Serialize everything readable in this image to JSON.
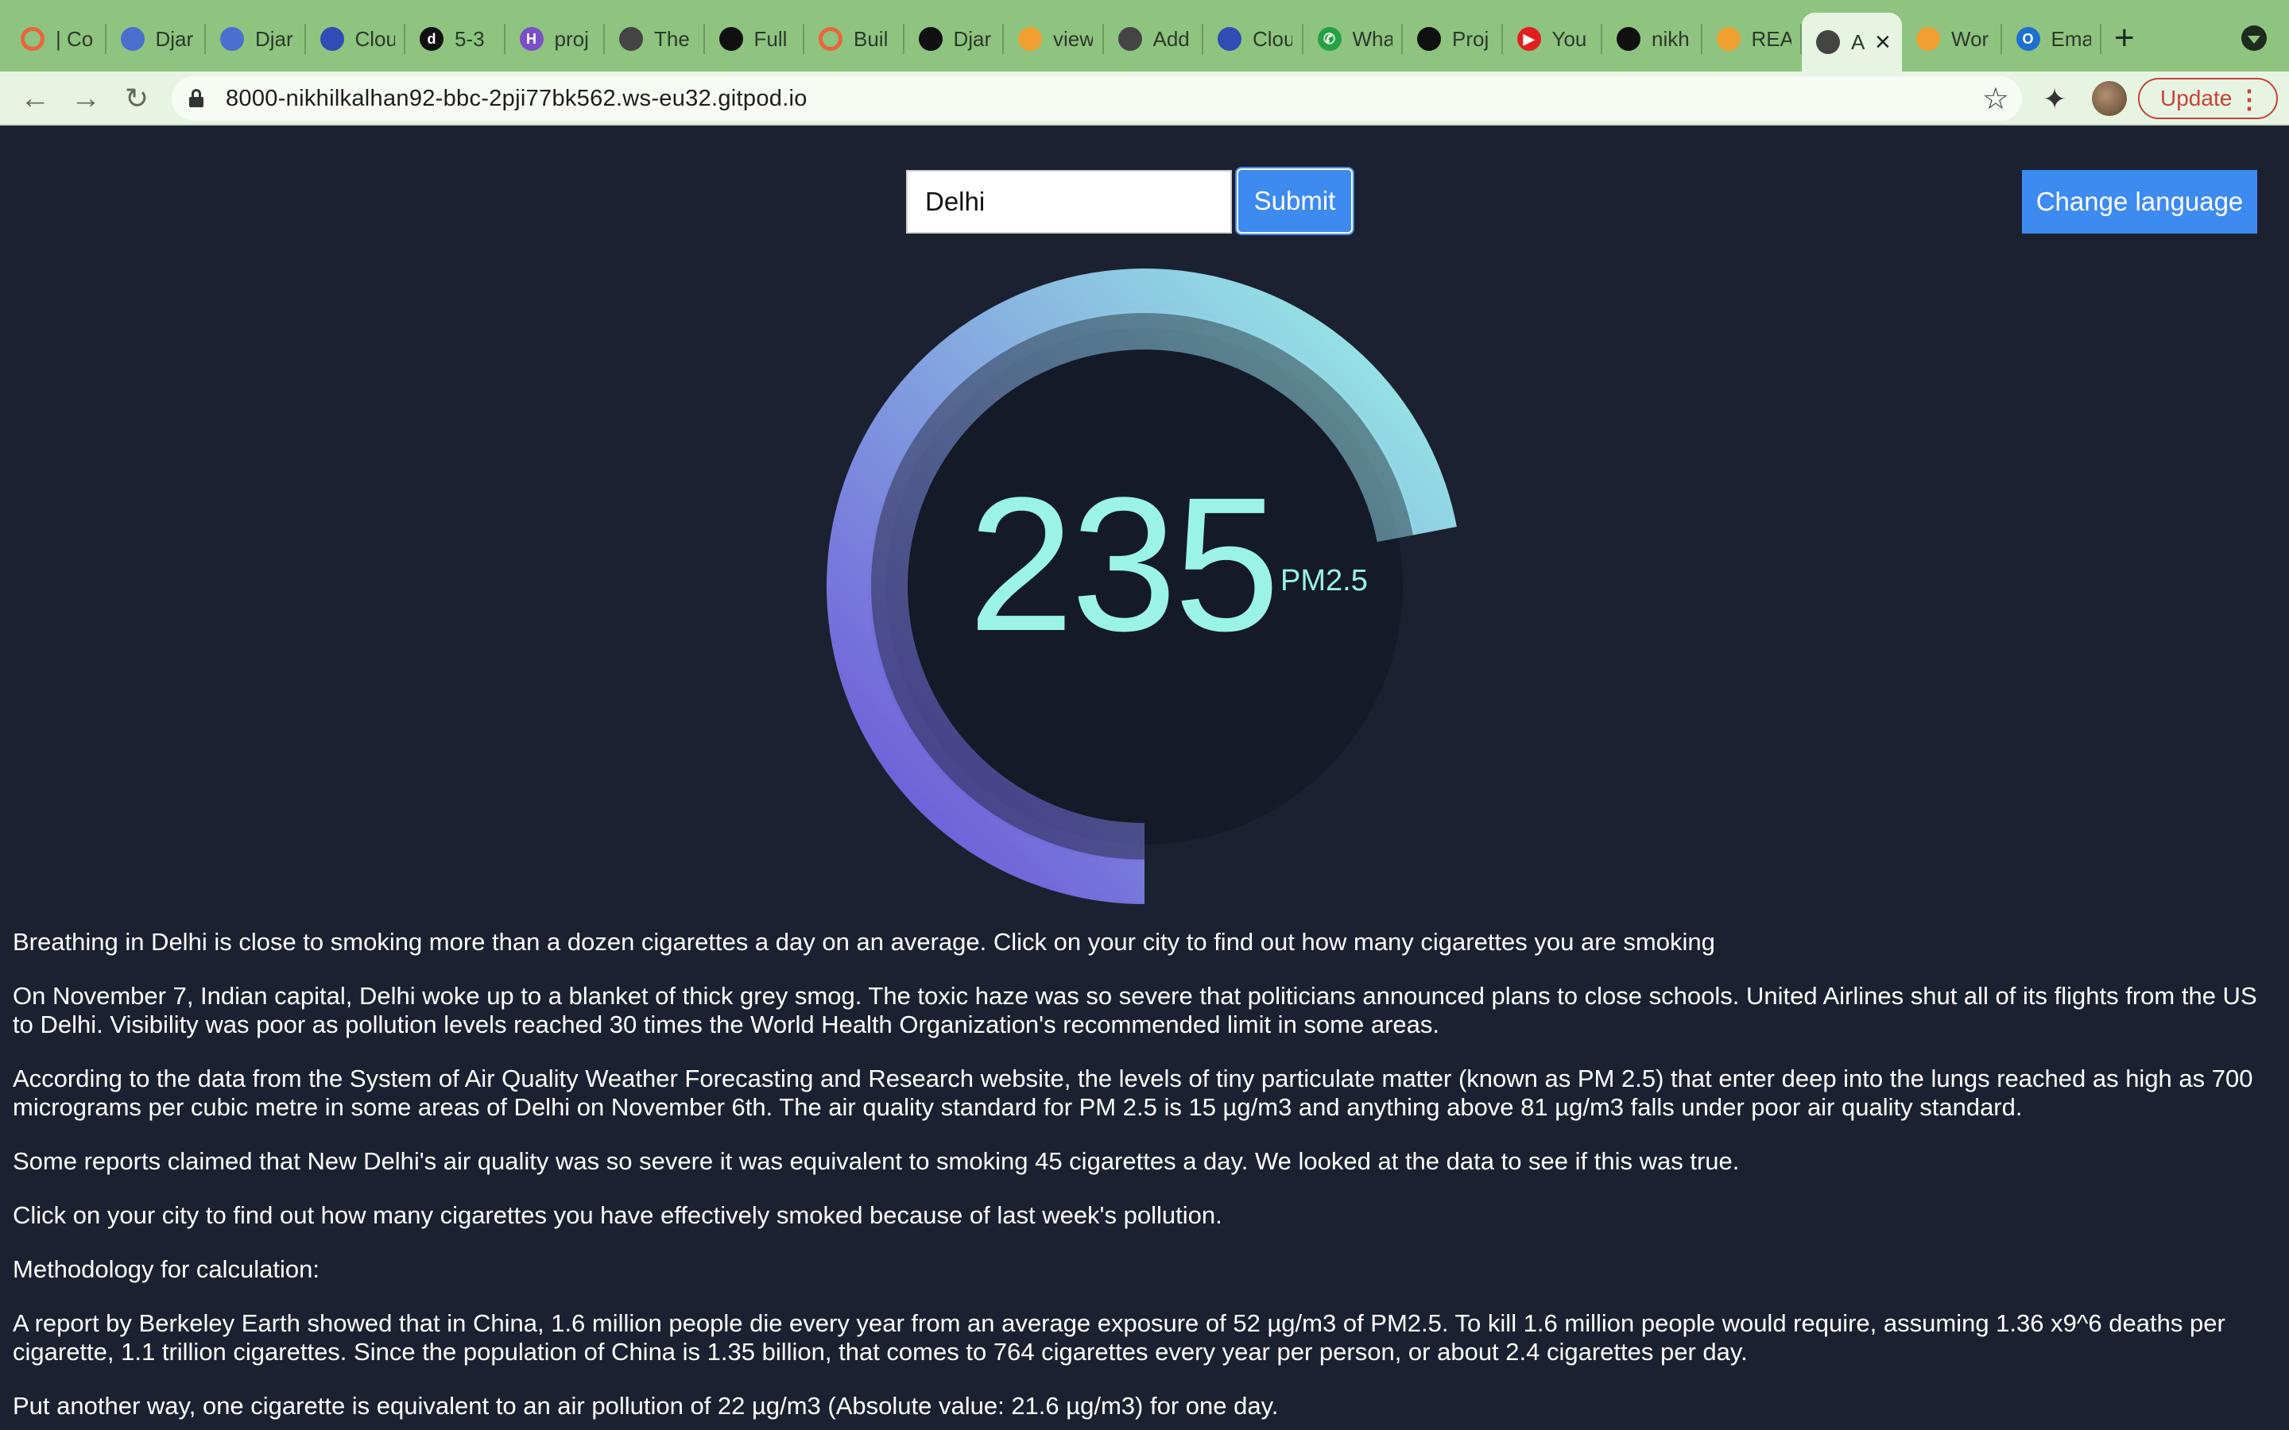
{
  "browser": {
    "tabs": [
      {
        "label": "| Co",
        "icon": "orange-ring-icon",
        "color": "#e8663a"
      },
      {
        "label": "Djar",
        "icon": "globe-crest-icon",
        "color": "#4a6fd1"
      },
      {
        "label": "Djar",
        "icon": "globe-crest-icon",
        "color": "#4a6fd1"
      },
      {
        "label": "Clou",
        "icon": "cloud-icon",
        "color": "#2f4db5"
      },
      {
        "label": "5-3",
        "icon": "d-letter-icon",
        "color": "#111111"
      },
      {
        "label": "proj",
        "icon": "h-letter-icon",
        "color": "#7b4fc9"
      },
      {
        "label": "The",
        "icon": "globe-icon",
        "color": "#444444"
      },
      {
        "label": "Full",
        "icon": "github-icon",
        "color": "#111111"
      },
      {
        "label": "Buil",
        "icon": "orange-ring-icon",
        "color": "#e8663a"
      },
      {
        "label": "Djar",
        "icon": "github-icon",
        "color": "#111111"
      },
      {
        "label": "view",
        "icon": "orange-swirl-icon",
        "color": "#f0a030"
      },
      {
        "label": "Add",
        "icon": "globe-icon",
        "color": "#444444"
      },
      {
        "label": "Clou",
        "icon": "cloud-icon",
        "color": "#2f4db5"
      },
      {
        "label": "Wha",
        "icon": "whatsapp-icon",
        "color": "#25a244"
      },
      {
        "label": "Proj",
        "icon": "github-icon",
        "color": "#111111"
      },
      {
        "label": "You",
        "icon": "youtube-icon",
        "color": "#e02020"
      },
      {
        "label": "nikh",
        "icon": "github-icon",
        "color": "#111111"
      },
      {
        "label": "REA",
        "icon": "orange-swirl-icon",
        "color": "#f0a030"
      },
      {
        "label": "A",
        "icon": "globe-icon",
        "color": "#444444",
        "active": true
      },
      {
        "label": "Wor",
        "icon": "orange-swirl-icon",
        "color": "#f0a030"
      },
      {
        "label": "Ema",
        "icon": "outlook-icon",
        "color": "#1f6fd1"
      }
    ],
    "url": "8000-nikhilkalhan92-bbc-2pji77bk562.ws-eu32.gitpod.io",
    "update_label": "Update"
  },
  "search": {
    "value": "Delhi",
    "submit_label": "Submit",
    "change_language_label": "Change language"
  },
  "gauge": {
    "value": "235",
    "unit": "PM2.5",
    "fill_fraction": 0.72,
    "colors": {
      "start": "#6b4fd8",
      "end": "#9af3e6",
      "track": "#141a27",
      "background": "#1b2130"
    }
  },
  "article": {
    "paragraphs": [
      "Breathing in Delhi is close to smoking more than a dozen cigarettes a day on an average. Click on your city to find out how many cigarettes you are smoking",
      "On November 7, Indian capital, Delhi woke up to a blanket of thick grey smog. The toxic haze was so severe that politicians announced plans to close schools. United Airlines shut all of its flights from the US to Delhi. Visibility was poor as pollution levels reached 30 times the World Health Organization's recommended limit in some areas.",
      "According to the data from the System of Air Quality Weather Forecasting and Research website, the levels of tiny particulate matter (known as PM 2.5) that enter deep into the lungs reached as high as 700 micrograms per cubic metre in some areas of Delhi on November 6th. The air quality standard for PM 2.5 is 15 µg/m3 and anything above 81 µg/m3 falls under poor air quality standard.",
      "Some reports claimed that New Delhi's air quality was so severe it was equivalent to smoking 45 cigarettes a day. We looked at the data to see if this was true.",
      "Click on your city to find out how many cigarettes you have effectively smoked because of last week's pollution.",
      "Methodology for calculation:",
      "A report by Berkeley Earth showed that in China, 1.6 million people die every year from an average exposure of 52 µg/m3 of PM2.5. To kill 1.6 million people would require, assuming 1.36 x9^6 deaths per cigarette, 1.1 trillion cigarettes. Since the population of China is 1.35 billion, that comes to 764 cigarettes every year per person, or about 2.4 cigarettes per day.",
      "Put another way, one cigarette is equivalent to an air pollution of 22 µg/m3 (Absolute value: 21.6 µg/m3) for one day."
    ]
  }
}
